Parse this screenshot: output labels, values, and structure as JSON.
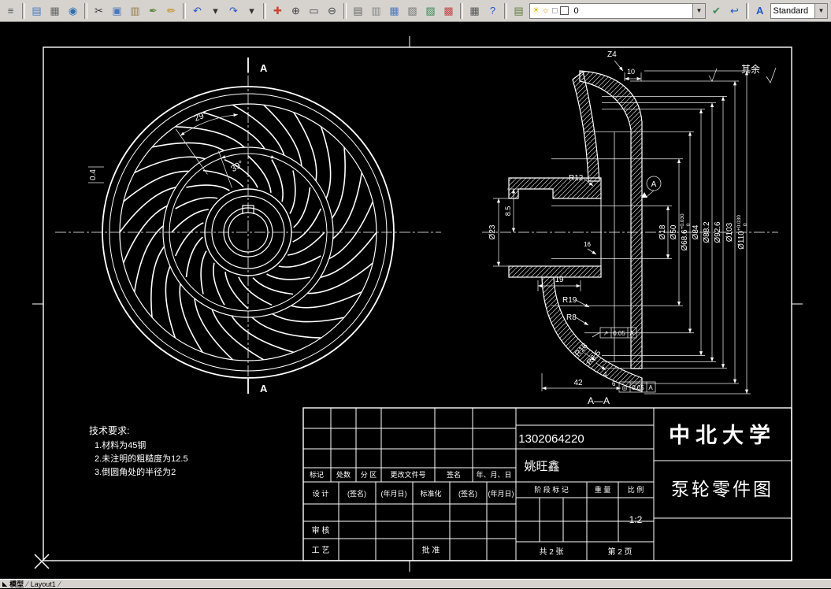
{
  "toolbar": {
    "items": [
      {
        "name": "properties-icon",
        "glyph": "≡",
        "color": "#555555"
      },
      {
        "type": "sep"
      },
      {
        "name": "new-icon",
        "glyph": "▤",
        "color": "#4a78c0"
      },
      {
        "name": "plot-icon",
        "glyph": "▦",
        "color": "#666666"
      },
      {
        "name": "publish-icon",
        "glyph": "◉",
        "color": "#2f6fb0"
      },
      {
        "type": "sep"
      },
      {
        "name": "cut-icon",
        "glyph": "✂",
        "color": "#333333"
      },
      {
        "name": "copy-icon",
        "glyph": "▣",
        "color": "#4a78c0"
      },
      {
        "name": "paste-icon",
        "glyph": "▥",
        "color": "#9a7b4f"
      },
      {
        "name": "match-properties-icon",
        "glyph": "✒",
        "color": "#5a8a3c"
      },
      {
        "name": "pencil-edit-icon",
        "glyph": "✏",
        "color": "#b8860b"
      },
      {
        "type": "sep"
      },
      {
        "name": "undo-icon",
        "glyph": "↶",
        "color": "#2255cc"
      },
      {
        "name": "undo-dropdown-icon",
        "glyph": "▾",
        "color": "#333333"
      },
      {
        "name": "redo-icon",
        "glyph": "↷",
        "color": "#2255cc"
      },
      {
        "name": "redo-dropdown-icon",
        "glyph": "▾",
        "color": "#333333"
      },
      {
        "type": "sep"
      },
      {
        "name": "pan-icon",
        "glyph": "✚",
        "color": "#cc4433"
      },
      {
        "name": "zoom-realtime-icon",
        "glyph": "⊕",
        "color": "#444444"
      },
      {
        "name": "zoom-window-icon",
        "glyph": "▭",
        "color": "#444444"
      },
      {
        "name": "zoom-previous-icon",
        "glyph": "⊖",
        "color": "#444444"
      },
      {
        "type": "sep"
      },
      {
        "name": "layer-properties-icon",
        "glyph": "▤",
        "color": "#666666"
      },
      {
        "name": "layer-states-icon",
        "glyph": "▥",
        "color": "#888888"
      },
      {
        "name": "table-icon",
        "glyph": "▦",
        "color": "#4a78c0"
      },
      {
        "name": "sheet-set-icon",
        "glyph": "▧",
        "color": "#777777"
      },
      {
        "name": "image-attach-icon",
        "glyph": "▨",
        "color": "#3c8a5a"
      },
      {
        "name": "etransmit-icon",
        "glyph": "▩",
        "color": "#c04a4a"
      },
      {
        "type": "sep"
      },
      {
        "name": "quick-calc-icon",
        "glyph": "▦",
        "color": "#555555"
      },
      {
        "name": "help-icon",
        "glyph": "?",
        "color": "#2255cc"
      },
      {
        "type": "sep"
      },
      {
        "name": "layers-toolbar-icon",
        "glyph": "▤",
        "color": "#5a7a3c"
      }
    ],
    "layer_combo": {
      "bulb_glyph": "☀",
      "freeze_glyph": "☼",
      "lock_glyph": "◻",
      "value": "0"
    },
    "after_items": [
      {
        "name": "make-object-layer-current-icon",
        "glyph": "✔",
        "color": "#3c8a5a"
      },
      {
        "name": "layer-previous-icon",
        "glyph": "↩",
        "color": "#2255cc"
      }
    ],
    "style_icon_glyph": "A",
    "style_combo_value": "Standard"
  },
  "statusbar": {
    "nav_glyph": "◣",
    "model_tab": "模型",
    "layout_tab": "Layout1",
    "sep": "/"
  },
  "drawing": {
    "surface_note": "其余",
    "front_view": {
      "angle_outer": "29°",
      "angle_inner": "39°",
      "roughness": "0.4",
      "section_label_top": "A",
      "section_label_bottom": "A"
    },
    "section_view": {
      "title": "A—A",
      "datum_label": "A",
      "callout_z": "Z4",
      "dim_10": "10",
      "dim_r12": "R12",
      "dim_d23": "Ø23",
      "dim_85": "8.5",
      "dim_16": "16",
      "dim_19": "19",
      "dim_r19": "R19",
      "dim_r8": "R8",
      "dim_r18": "R18",
      "dim_r65": "R6.5",
      "dim_42": "42",
      "dim_4": "4",
      "dim_6": "6",
      "right_dims": [
        {
          "label": "Ø18",
          "tol_top": "",
          "tol_bot": ""
        },
        {
          "label": "Ø50",
          "tol_top": "",
          "tol_bot": ""
        },
        {
          "label": "Ø68.6",
          "tol_top": "+0.030",
          "tol_bot": "0"
        },
        {
          "label": "Ø84",
          "tol_top": "",
          "tol_bot": ""
        },
        {
          "label": "Ø88.2",
          "tol_top": "",
          "tol_bot": ""
        },
        {
          "label": "Ø92.6",
          "tol_top": "",
          "tol_bot": ""
        },
        {
          "label": "Ø103",
          "tol_top": "",
          "tol_bot": ""
        },
        {
          "label": "Ø110",
          "tol_top": "+0.030",
          "tol_bot": "0"
        }
      ],
      "gdt1": {
        "sym": "↗",
        "val": "0.05",
        "datum": "A"
      },
      "gdt2": {
        "sym": "◎",
        "val": "0.05",
        "datum": "A"
      }
    },
    "tech_req": {
      "title": "技术要求:",
      "lines": [
        "1.材料为45钢",
        "2.未注明的粗糙度为12.5",
        "3.倒圆角处的半径为2"
      ]
    },
    "title_block": {
      "university": "中北大学",
      "part_name": "泵轮零件图",
      "student_id": "1302064220",
      "student_name": "姚旺鑫",
      "rev_headers": [
        "标记",
        "处数",
        "分 区",
        "更改文件号",
        "签名",
        "年、月、日"
      ],
      "row_design": [
        "设 计",
        "(签名)",
        "(年月日)",
        "标准化",
        "(签名)",
        "(年月日)"
      ],
      "row_check": "审 核",
      "row_process": "工 艺",
      "row_approve": "批 准",
      "stage_header": "阶 段 标 记",
      "weight_header": "重 量",
      "scale_header": "比 例",
      "scale_value": "1:2",
      "sheets_total": "共 2 张",
      "sheet_no": "第 2 页"
    }
  }
}
